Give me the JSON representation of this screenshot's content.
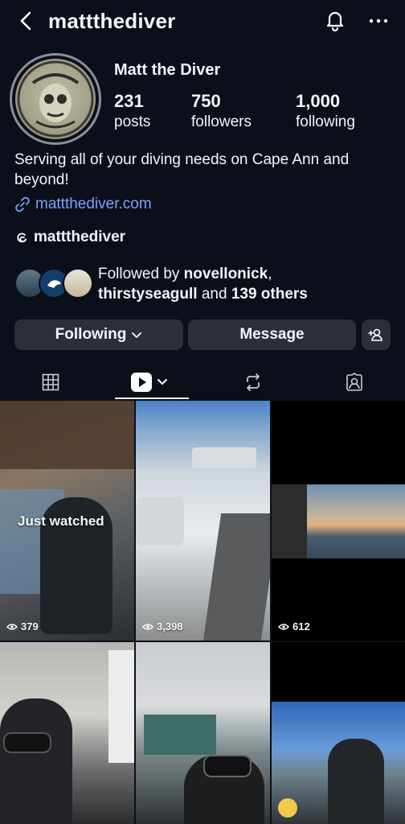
{
  "header": {
    "handle": "mattthediver",
    "icons": [
      "chevron-left-icon",
      "bell-icon",
      "more-icon"
    ]
  },
  "profile": {
    "display_name": "Matt the Diver",
    "stats": [
      {
        "value": "231",
        "label": "posts"
      },
      {
        "value": "750",
        "label": "followers"
      },
      {
        "value": "1,000",
        "label": "following"
      }
    ],
    "bio": "Serving all of your diving needs on Cape Ann and beyond!",
    "website": "mattthediver.com",
    "threads_handle": "mattthediver"
  },
  "followed_by": {
    "prefix": "Followed by ",
    "user1": "novellonick",
    "sep": ",",
    "user2": "thirstyseagull",
    "and_text": " and ",
    "others": "139 others"
  },
  "actions": {
    "following_label": "Following",
    "message_label": "Message"
  },
  "tabs": [
    "grid-icon",
    "reels-icon",
    "reposts-icon",
    "tagged-icon"
  ],
  "grid": {
    "just_watched": "Just watched",
    "views": [
      "379",
      "3,398",
      "612"
    ]
  },
  "colors": {
    "background": "#0b0f1a",
    "button": "#2b2f37",
    "link": "#7aa3ff"
  }
}
